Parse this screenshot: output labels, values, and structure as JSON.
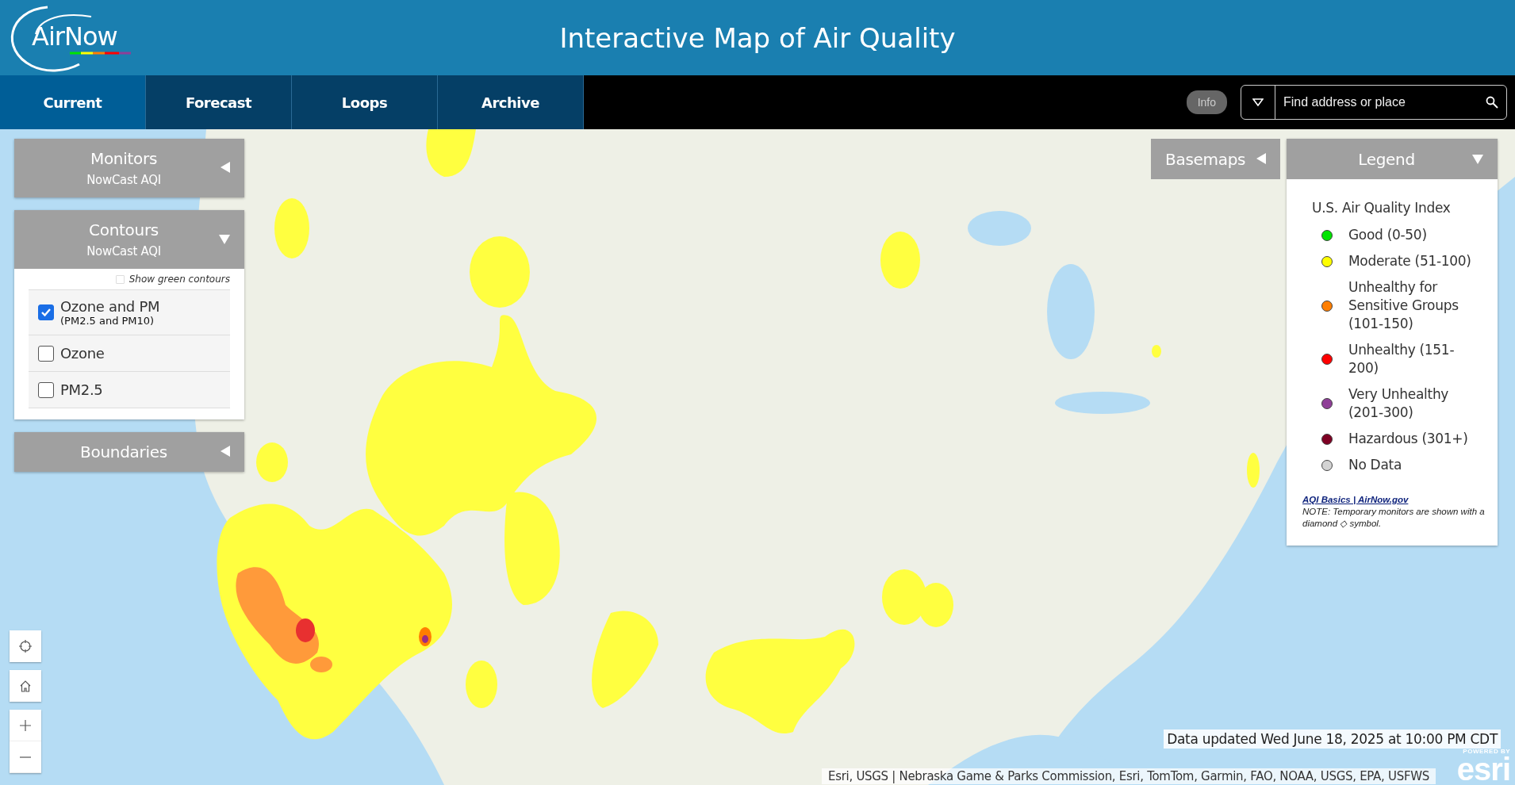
{
  "header": {
    "logo": "AirNow",
    "title": "Interactive Map of Air Quality"
  },
  "tabs": [
    {
      "label": "Current",
      "selected": true
    },
    {
      "label": "Forecast",
      "selected": false
    },
    {
      "label": "Loops",
      "selected": false
    },
    {
      "label": "Archive",
      "selected": false
    }
  ],
  "info_button": "Info",
  "search": {
    "placeholder": "Find address or place"
  },
  "layer_panels": [
    {
      "title": "Monitors",
      "subtitle": "NowCast AQI",
      "expanded": false
    },
    {
      "title": "Contours",
      "subtitle": "NowCast AQI",
      "expanded": true,
      "show_green_contours": {
        "label": "Show green contours",
        "checked": false
      },
      "options": [
        {
          "label": "Ozone and PM",
          "note": "(PM2.5 and PM10)",
          "checked": true
        },
        {
          "label": "Ozone",
          "checked": false
        },
        {
          "label": "PM2.5",
          "checked": false
        }
      ]
    },
    {
      "title": "Boundaries",
      "expanded": false
    }
  ],
  "basemaps": {
    "title": "Basemaps",
    "expanded": false
  },
  "legend": {
    "title": "Legend",
    "expanded": true,
    "heading": "U.S. Air Quality Index",
    "items": [
      {
        "label": "Good (0-50)",
        "color": "#00e400"
      },
      {
        "label": "Moderate (51-100)",
        "color": "#ffff00"
      },
      {
        "label": "Unhealthy for Sensitive Groups (101-150)",
        "color": "#ff7e00"
      },
      {
        "label": "Unhealthy (151-200)",
        "color": "#ff0000"
      },
      {
        "label": "Very Unhealthy (201-300)",
        "color": "#8f3f97"
      },
      {
        "label": "Hazardous (301+)",
        "color": "#7e0023"
      },
      {
        "label": "No Data",
        "color": "#d3d3d3"
      }
    ],
    "link": "AQI Basics | AirNow.gov",
    "note": "NOTE: Temporary monitors are shown with a diamond ◇ symbol."
  },
  "data_updated": "Data updated Wed June 18, 2025 at 10:00 PM CDT",
  "attribution": "Esri, USGS | Nebraska Game & Parks Commission, Esri, TomTom, Garmin, FAO, NOAA, USGS, EPA, USFWS",
  "powered_by": {
    "label": "POWERED BY",
    "brand": "esri"
  }
}
